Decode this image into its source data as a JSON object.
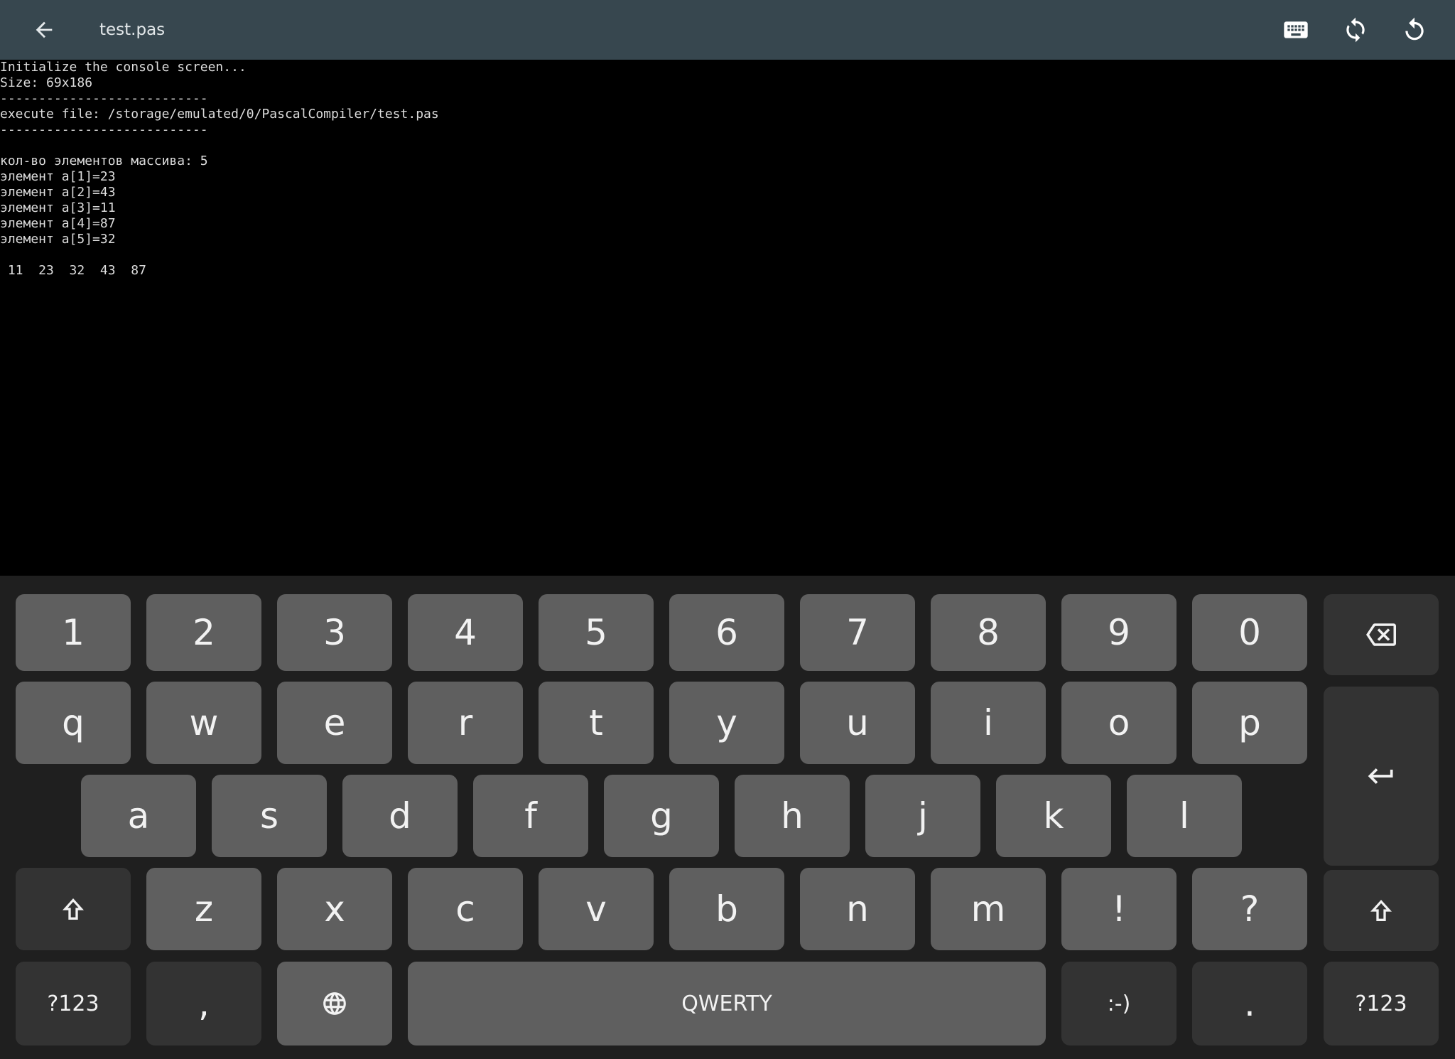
{
  "appbar": {
    "title": "test.pas",
    "back_icon": "arrow-back-icon",
    "actions": [
      {
        "icon": "keyboard-icon"
      },
      {
        "icon": "sync-icon"
      },
      {
        "icon": "restart-icon"
      }
    ],
    "background": "#37474f"
  },
  "console": {
    "lines": [
      "Initialize the console screen...",
      "Size: 69x186",
      "---------------------------",
      "execute file: /storage/emulated/0/PascalCompiler/test.pas",
      "---------------------------",
      "",
      "кол-во элементов массива: 5",
      "элемент a[1]=23",
      "элемент a[2]=43",
      "элемент a[3]=11",
      "элемент a[4]=87",
      "элемент a[5]=32",
      "",
      " 11  23  32  43  87"
    ]
  },
  "keyboard": {
    "row_numbers": [
      "1",
      "2",
      "3",
      "4",
      "5",
      "6",
      "7",
      "8",
      "9",
      "0"
    ],
    "row_q": [
      "q",
      "w",
      "e",
      "r",
      "t",
      "y",
      "u",
      "i",
      "o",
      "p"
    ],
    "row_a": [
      "a",
      "s",
      "d",
      "f",
      "g",
      "h",
      "j",
      "k",
      "l"
    ],
    "row_z": [
      "z",
      "x",
      "c",
      "v",
      "b",
      "n",
      "m",
      "!",
      "?"
    ],
    "bottom": {
      "symbols_left": "?123",
      "comma": ",",
      "space": "QWERTY",
      "emoticon": ":-)",
      "period": ".",
      "symbols_right": "?123"
    },
    "icons": {
      "backspace": "backspace-icon",
      "enter": "enter-icon",
      "shift": "shift-icon",
      "globe": "globe-icon"
    }
  }
}
